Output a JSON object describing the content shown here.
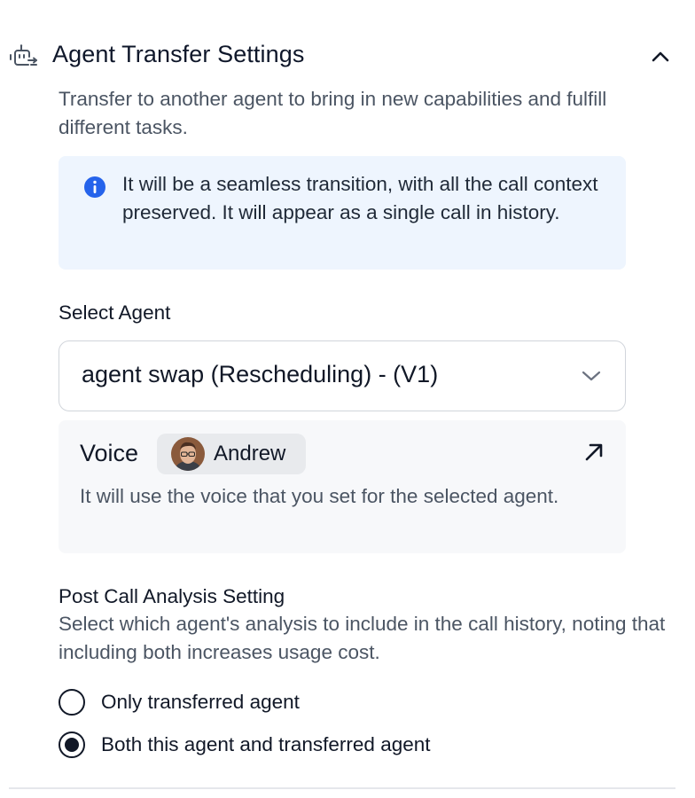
{
  "header": {
    "icon": "bot-transfer-icon",
    "title": "Agent Transfer Settings",
    "collapse_icon": "chevron-up-icon"
  },
  "description": "Transfer to another agent to bring in new capabilities and fulfill different tasks.",
  "info": {
    "icon": "info-icon",
    "text": "It will be a seamless transition, with all the call context preserved. It will appear as a single call in history.",
    "accent": "#2563eb",
    "background": "#eef5fe"
  },
  "select_agent": {
    "label": "Select Agent",
    "value": "agent swap (Rescheduling) - (V1)",
    "icon": "chevron-down-icon"
  },
  "voice": {
    "label": "Voice",
    "name": "Andrew",
    "avatar": "avatar",
    "open_icon": "arrow-up-right-icon",
    "note": "It will use the voice that you set for the selected agent."
  },
  "post_call": {
    "title": "Post Call Analysis Setting",
    "description": "Select which agent's analysis to include in the call history, noting that including both increases usage cost.",
    "options": [
      {
        "label": "Only transferred agent",
        "selected": false
      },
      {
        "label": "Both this agent and transferred agent",
        "selected": true
      }
    ]
  }
}
